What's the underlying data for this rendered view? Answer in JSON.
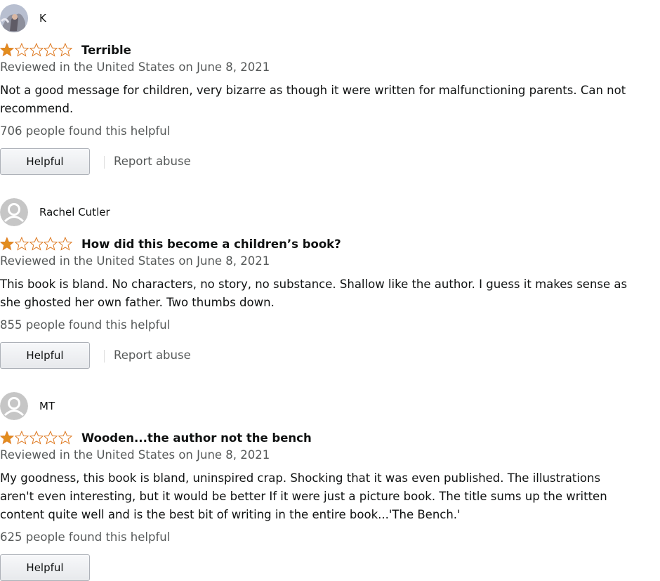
{
  "reviews": [
    {
      "author": "K",
      "avatar_type": "photo",
      "rating": 1,
      "rating_max": 5,
      "title": "Terrible",
      "date": "Reviewed in the United States on June 8, 2021",
      "body": "Not a good message for children, very bizarre as though it were written for malfunctioning parents. Can not recommend.",
      "helpful_count": "706 people found this helpful",
      "helpful_button": "Helpful",
      "report_link": "Report abuse"
    },
    {
      "author": "Rachel Cutler",
      "avatar_type": "default-user-icon",
      "rating": 1,
      "rating_max": 5,
      "title": "How did this become a children’s book?",
      "date": "Reviewed in the United States on June 8, 2021",
      "body": "This book is bland. No characters, no story, no substance. Shallow like the author. I guess it makes sense as she ghosted her own father. Two thumbs down.",
      "helpful_count": "855 people found this helpful",
      "helpful_button": "Helpful",
      "report_link": "Report abuse"
    },
    {
      "author": "MT",
      "avatar_type": "default-user-icon",
      "rating": 1,
      "rating_max": 5,
      "title": "Wooden...the author not the bench",
      "date": "Reviewed in the United States on June 8, 2021",
      "body": "My goodness, this book is bland, uninspired crap. Shocking that it was even published. The illustrations aren't even interesting, but it would be better If it were just a picture book. The title sums up the written content quite well and is the best bit of writing in the entire book...'The Bench.'",
      "helpful_count": "625 people found this helpful",
      "helpful_button": "Helpful"
    }
  ],
  "colors": {
    "star_fill": "#e28d1e",
    "star_outline": "#de7921",
    "muted_text": "#565959",
    "body_text": "#0f1111",
    "avatar_bg": "#c6c6c6",
    "avatar_fg": "#ffffff"
  }
}
